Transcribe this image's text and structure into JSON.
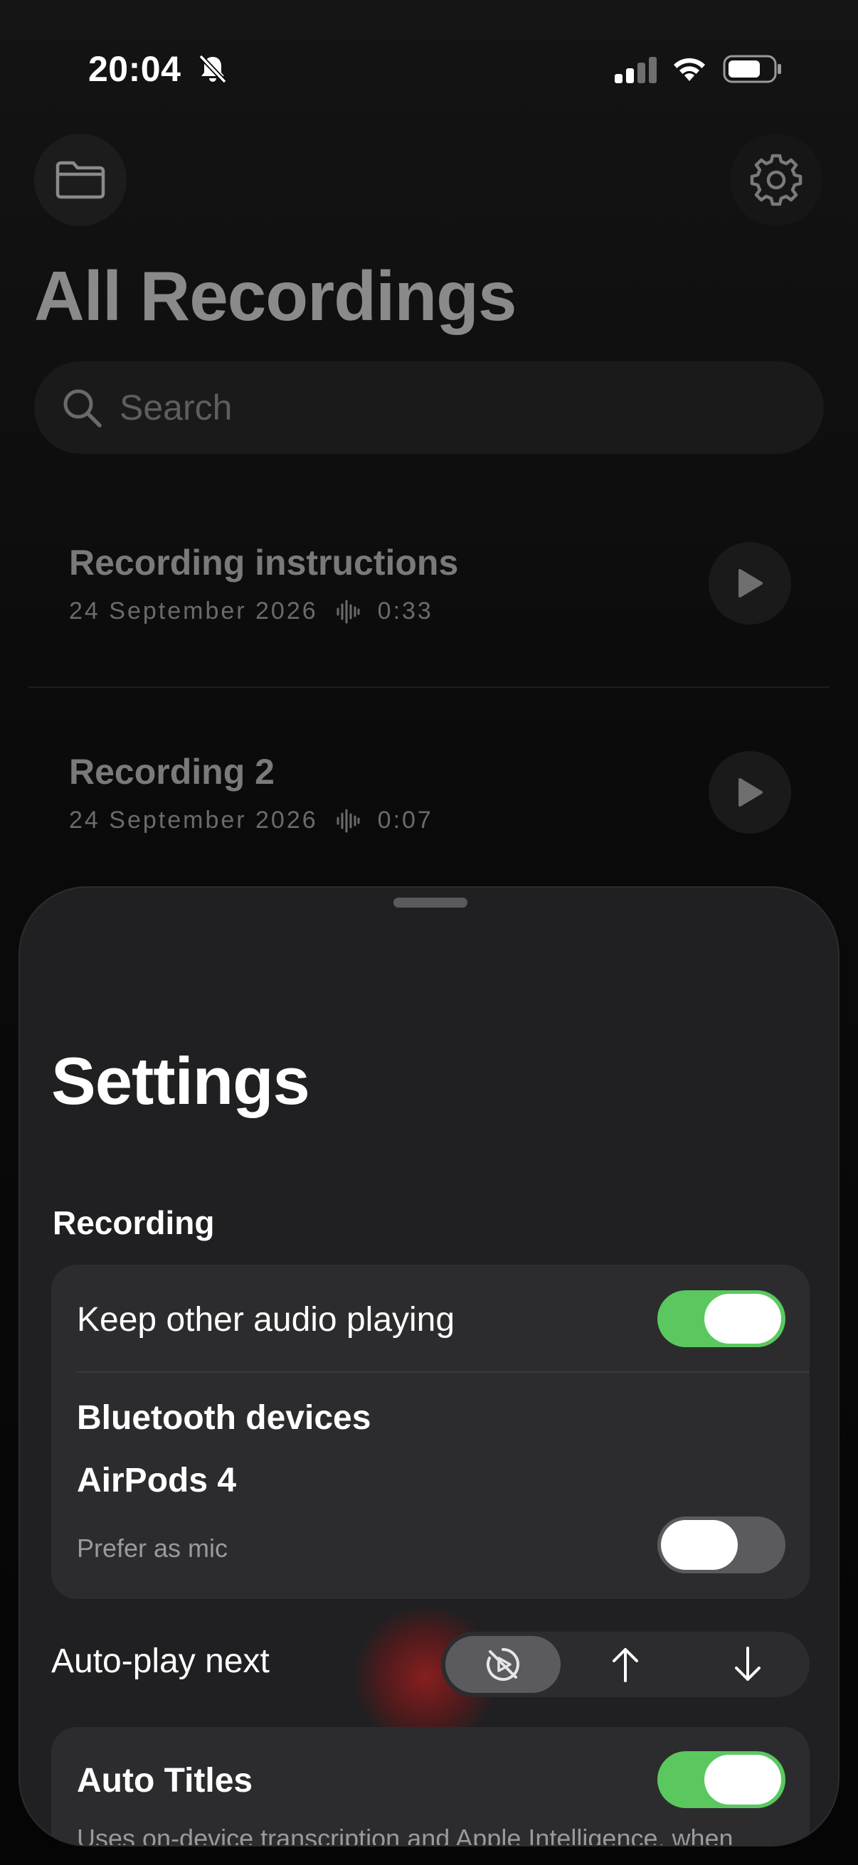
{
  "status_bar": {
    "time": "20:04",
    "icons": [
      "bell-slash-icon",
      "cellular-signal-icon",
      "wifi-icon",
      "battery-icon"
    ]
  },
  "toolbar": {
    "left_icon": "folder-icon",
    "right_icon": "gear-icon"
  },
  "page": {
    "title": "All Recordings"
  },
  "search": {
    "placeholder": "Search",
    "icon": "search-icon"
  },
  "recordings": [
    {
      "title": "Recording instructions",
      "date": "24 September 2026",
      "duration": "0:33"
    },
    {
      "title": "Recording 2",
      "date": "24 September 2026",
      "duration": "0:07"
    }
  ],
  "settings": {
    "title": "Settings",
    "recording_section": {
      "header": "Recording",
      "keep_audio_label": "Keep other audio playing",
      "keep_audio_on": true,
      "bluetooth_header": "Bluetooth devices",
      "device_name": "AirPods 4",
      "prefer_mic_label": "Prefer as mic",
      "prefer_mic_on": false
    },
    "autoplay": {
      "label": "Auto-play next",
      "options": [
        "autoplay-off-icon",
        "arrow-up-icon",
        "arrow-down-icon"
      ],
      "selected": "autoplay-off-icon"
    },
    "auto_titles": {
      "label": "Auto Titles",
      "on": true,
      "description": "Uses on-device transcription and Apple Intelligence, when"
    }
  },
  "colors": {
    "toggle_on": "#5ac85f",
    "sheet_bg": "#202022",
    "card_bg": "#2c2c2e"
  }
}
